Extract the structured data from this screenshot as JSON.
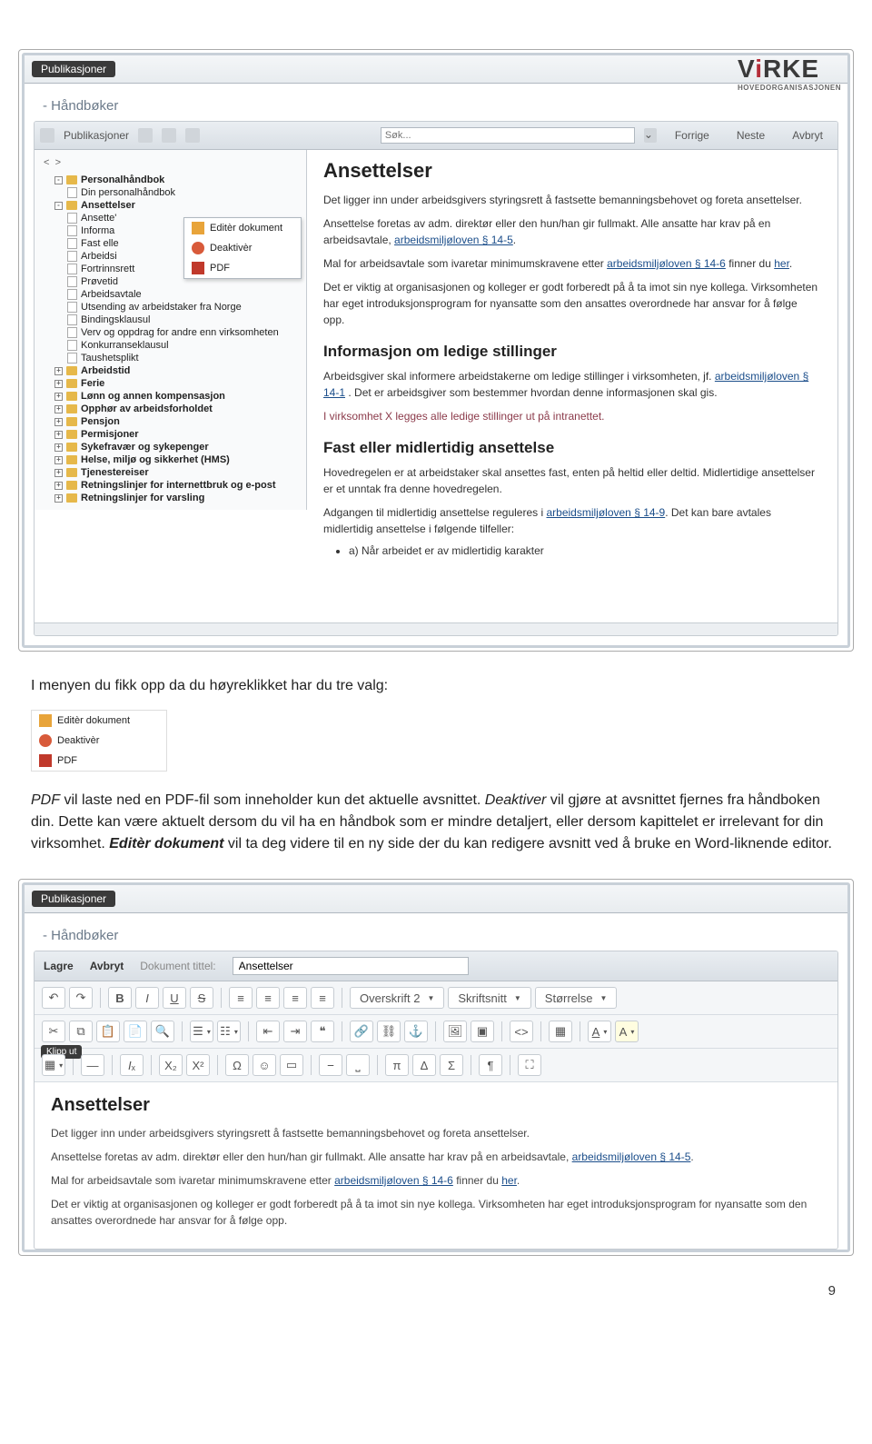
{
  "logo": {
    "text": "VIRKE",
    "sub": "HOVEDORGANISASJONEN"
  },
  "app": {
    "tab": "Publikasjoner",
    "section": "Håndbøker",
    "toolbar": {
      "pub_label": "Publikasjoner",
      "search_placeholder": "Søk...",
      "prev": "Forrige",
      "next": "Neste",
      "cancel": "Avbryt"
    },
    "nav": {
      "back": "<",
      "fwd": ">"
    },
    "tree": [
      {
        "lvl": 1,
        "exp": "-",
        "bold": true,
        "label": "Personalhåndbok"
      },
      {
        "lvl": 2,
        "page": true,
        "label": "Din personalhåndbok"
      },
      {
        "lvl": 1,
        "exp": "-",
        "bold": true,
        "label": "Ansettelser"
      },
      {
        "lvl": 2,
        "page": true,
        "label": "Ansette'"
      },
      {
        "lvl": 2,
        "page": true,
        "label": "Informa"
      },
      {
        "lvl": 2,
        "page": true,
        "label": "Fast elle"
      },
      {
        "lvl": 2,
        "page": true,
        "label": "Arbeidsi"
      },
      {
        "lvl": 2,
        "page": true,
        "label": "Fortrinnsrett"
      },
      {
        "lvl": 2,
        "page": true,
        "label": "Prøvetid"
      },
      {
        "lvl": 2,
        "page": true,
        "label": "Arbeidsavtale"
      },
      {
        "lvl": 2,
        "page": true,
        "label": "Utsending av arbeidstaker fra Norge"
      },
      {
        "lvl": 2,
        "page": true,
        "label": "Bindingsklausul"
      },
      {
        "lvl": 2,
        "page": true,
        "label": "Verv og oppdrag for andre enn virksomheten"
      },
      {
        "lvl": 2,
        "page": true,
        "label": "Konkurranseklausul"
      },
      {
        "lvl": 2,
        "page": true,
        "label": "Taushetsplikt"
      },
      {
        "lvl": 1,
        "exp": "+",
        "bold": true,
        "label": "Arbeidstid"
      },
      {
        "lvl": 1,
        "exp": "+",
        "bold": true,
        "label": "Ferie"
      },
      {
        "lvl": 1,
        "exp": "+",
        "bold": true,
        "label": "Lønn og annen kompensasjon"
      },
      {
        "lvl": 1,
        "exp": "+",
        "bold": true,
        "label": "Opphør av arbeidsforholdet"
      },
      {
        "lvl": 1,
        "exp": "+",
        "bold": true,
        "label": "Pensjon"
      },
      {
        "lvl": 1,
        "exp": "+",
        "bold": true,
        "label": "Permisjoner"
      },
      {
        "lvl": 1,
        "exp": "+",
        "bold": true,
        "label": "Sykefravær og sykepenger"
      },
      {
        "lvl": 1,
        "exp": "+",
        "bold": true,
        "label": "Helse, miljø og sikkerhet (HMS)"
      },
      {
        "lvl": 1,
        "exp": "+",
        "bold": true,
        "label": "Tjenestereiser"
      },
      {
        "lvl": 1,
        "exp": "+",
        "bold": true,
        "label": "Retningslinjer for internettbruk og e-post"
      },
      {
        "lvl": 1,
        "exp": "+",
        "bold": true,
        "label": "Retningslinjer for varsling"
      }
    ],
    "ctx": {
      "edit": "Editèr dokument",
      "deact": "Deaktivèr",
      "pdf": "PDF"
    },
    "content": {
      "h1": "Ansettelser",
      "p1": "Det ligger inn under arbeidsgivers styringsrett å fastsette bemanningsbehovet og foreta ansettelser.",
      "p2a": "Ansettelse foretas av adm. direktør eller den hun/han gir fullmakt. Alle ansatte har krav på en arbeidsavtale, ",
      "p2link": "arbeidsmiljøloven § 14-5",
      "p2b": ".",
      "p3a": "Mal for arbeidsavtale som ivaretar minimumskravene etter ",
      "p3link": "arbeidsmiljøloven § 14-6",
      "p3b": " finner du ",
      "p3link2": "her",
      "p3c": ".",
      "p4": "Det er viktig at organisasjonen og kolleger er godt forberedt på å ta imot sin nye kollega. Virksomheten har eget introduksjonsprogram for nyansatte som den ansattes overordnede har ansvar for å følge opp.",
      "h2a": "Informasjon om ledige stillinger",
      "p5a": "Arbeidsgiver skal informere arbeidstakerne om ledige stillinger i virksomheten, jf. ",
      "p5link": "arbeidsmiljøloven § 14-1",
      "p5b": " . Det er arbeidsgiver som bestemmer hvordan denne informasjonen skal gis.",
      "p6": "I virksomhet X legges alle ledige stillinger ut på intranettet.",
      "h2b": "Fast eller midlertidig ansettelse",
      "p7": "Hovedregelen er at arbeidstaker skal ansettes fast, enten på heltid eller deltid. Midlertidige ansettelser er et unntak fra denne hovedregelen.",
      "p8a": "Adgangen til midlertidig ansettelse reguleres i ",
      "p8link": "arbeidsmiljøloven § 14-9",
      "p8b": ". Det kan bare avtales midlertidig ansettelse i følgende tilfeller:",
      "li1": "a) Når arbeidet er av midlertidig karakter"
    }
  },
  "doc": {
    "p1": "I menyen du fikk opp da du høyreklikket har du tre valg:",
    "p2a": "PDF",
    "p2b": " vil laste ned en PDF-fil som inneholder kun det aktuelle avsnittet. ",
    "p2c": "Deaktiver",
    "p2d": " vil gjøre at avsnittet fjernes fra håndboken din. Dette kan være aktuelt dersom du vil ha en håndbok som er mindre detaljert, eller dersom kapittelet er irrelevant for din virksomhet. ",
    "p2e": "Editèr dokument",
    "p2f": " vil ta deg videre til en ny side der du kan redigere avsnitt ved å bruke en Word-liknende editor."
  },
  "editor": {
    "tab": "Publikasjoner",
    "section": "Håndbøker",
    "save": "Lagre",
    "cancel": "Avbryt",
    "title_label": "Dokument tittel:",
    "title_value": "Ansettelser",
    "dd_style": "Overskrift 2",
    "dd_font": "Skriftsnitt",
    "dd_size": "Størrelse",
    "tooltip": "Klipp ut",
    "content": {
      "h1": "Ansettelser",
      "p1": "Det ligger inn under arbeidsgivers styringsrett å fastsette bemanningsbehovet og foreta ansettelser.",
      "p2a": "Ansettelse foretas av adm. direktør eller den hun/han gir fullmakt. Alle ansatte har krav på en arbeidsavtale, ",
      "p2link": "arbeidsmiljøloven § 14-5",
      "p2b": ".",
      "p3a": "Mal for arbeidsavtale som ivaretar minimumskravene etter ",
      "p3link": "arbeidsmiljøloven § 14-6",
      "p3b": " finner du ",
      "p3link2": "her",
      "p3c": ".",
      "p4": "Det er viktig at organisasjonen og kolleger er godt forberedt på å ta imot sin nye kollega. Virksomheten har eget introduksjonsprogram for nyansatte som den ansattes overordnede har ansvar for å følge opp."
    }
  },
  "pagenum": "9"
}
